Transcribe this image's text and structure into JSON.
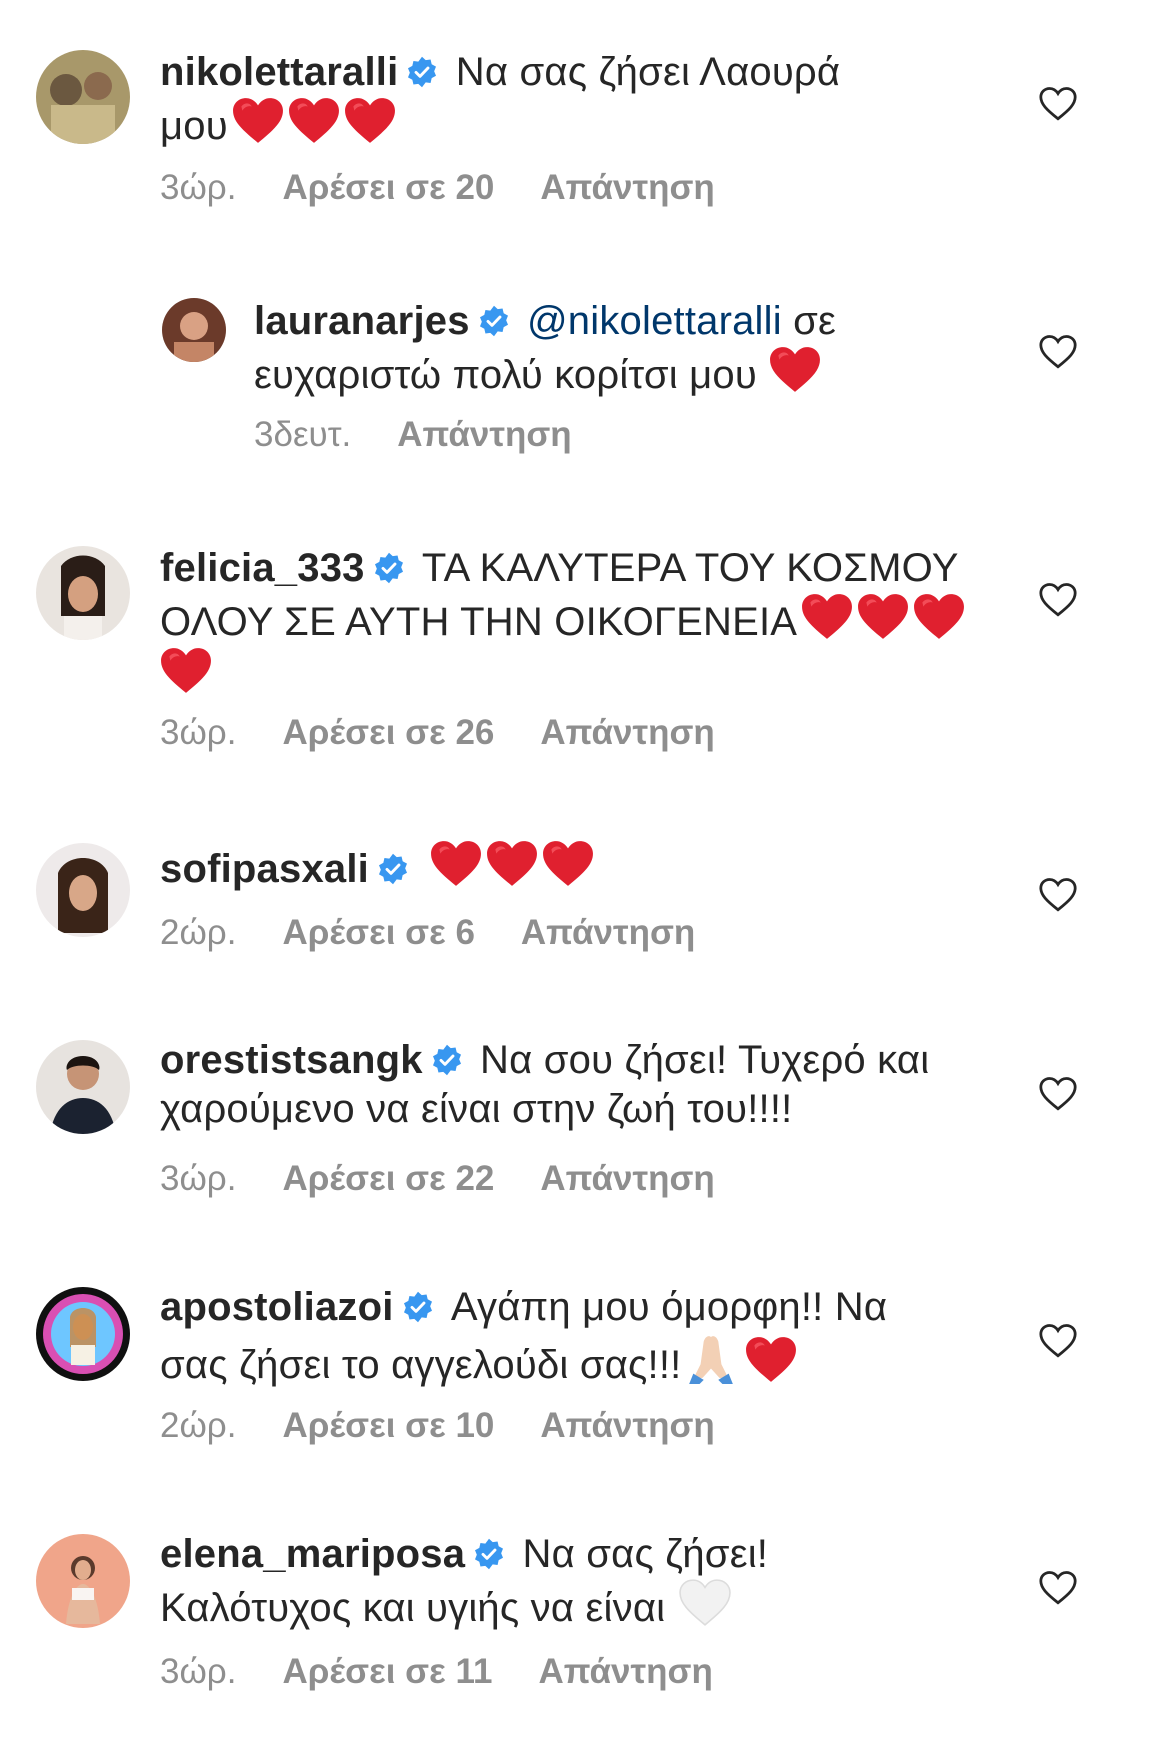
{
  "comments": [
    {
      "username": "nikolettaralli",
      "text": "Να σας ζήσει Λαουρά μου",
      "hearts": 3,
      "time": "3ώρ.",
      "likes": "Αρέσει σε 20",
      "reply": "Απάντηση"
    },
    {
      "username": "lauranarjes",
      "mention": "@nikolettaralli",
      "text": "σε ευχαριστώ πολύ κορίτσι μου",
      "hearts": 1,
      "time": "3δευτ.",
      "reply": "Απάντηση"
    },
    {
      "username": "felicia_333",
      "text": "ΤΑ ΚΑΛΥΤΕΡΑ ΤΟΥ ΚΟΣΜΟΥ ΟΛΟΥ ΣΕ ΑΥΤΗ ΤΗΝ ΟΙΚΟΓΕΝΕΙΑ",
      "hearts": 4,
      "time": "3ώρ.",
      "likes": "Αρέσει σε 26",
      "reply": "Απάντηση"
    },
    {
      "username": "sofipasxali",
      "text": "",
      "hearts": 3,
      "time": "2ώρ.",
      "likes": "Αρέσει σε 6",
      "reply": "Απάντηση"
    },
    {
      "username": "orestistsangk",
      "text": "Να σου ζήσει! Τυχερό και χαρούμενο να είναι στην ζωή του!!!!",
      "time": "3ώρ.",
      "likes": "Αρέσει σε 22",
      "reply": "Απάντηση"
    },
    {
      "username": "apostoliazoi",
      "text": "Αγάπη μου όμορφη!! Να σας ζήσει το αγγελούδι σας!!!",
      "emoji": "🙏🏻",
      "hearts": 1,
      "time": "2ώρ.",
      "likes": "Αρέσει σε 10",
      "reply": "Απάντηση"
    },
    {
      "username": "elena_mariposa",
      "text": "Να σας ζήσει! Καλότυχος και υγιής να είναι",
      "white_heart": true,
      "time": "3ώρ.",
      "likes": "Αρέσει σε 11",
      "reply": "Απάντηση"
    }
  ],
  "icons": {
    "verified_color": "#3897f0",
    "heart_color": "#e0202f",
    "like_outline_color": "#262626"
  }
}
